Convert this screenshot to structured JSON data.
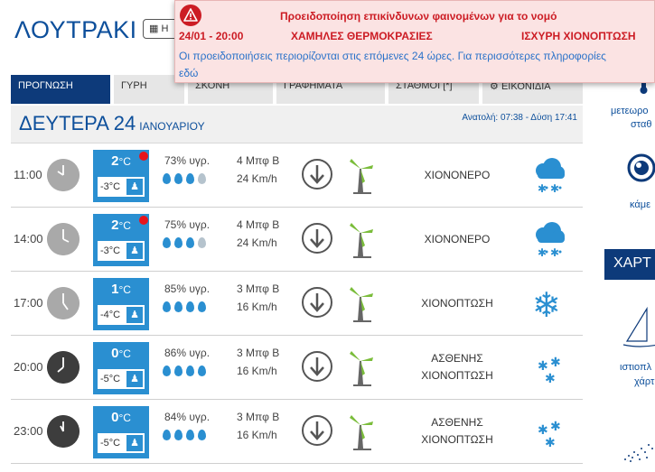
{
  "header": {
    "city": "ΛΟΥΤΡΑΚΙ",
    "date_button": "Η"
  },
  "tabs": [
    {
      "label": "ΠΡΟΓΝΩΣΗ",
      "active": true
    },
    {
      "label": "ΓΥΡΗ",
      "active": false
    },
    {
      "label": "ΣΚΟΝΗ",
      "active": false
    },
    {
      "label": "ΓΡΑΦΗΜΑΤΑ",
      "active": false
    },
    {
      "label": "ΣΤΑΘΜΟΙ [*]",
      "active": false
    },
    {
      "label": "ΕΙΚΟΝΙΔΙΑ",
      "active": false
    }
  ],
  "day": {
    "name": "ΔΕΥΤΕΡΑ 24",
    "month": "ΙΑΝΟΥΑΡΙΟΥ",
    "sun": "Ανατολή: 07:38 - Δύση 17:41"
  },
  "rows": [
    {
      "time": "11:00",
      "temp": "2",
      "temp_unit": "°C",
      "feel": "-3°C",
      "humidity": "73% υγρ.",
      "drops_full": 3,
      "wind_bf": "4 Μπφ Β",
      "wind_kmh": "24 Km/h",
      "cond": [
        "ΧΙΟΝΟΝΕΡΟ"
      ],
      "icon": "cloud-snow-icon",
      "warning": true,
      "night": false
    },
    {
      "time": "14:00",
      "temp": "2",
      "temp_unit": "°C",
      "feel": "-3°C",
      "humidity": "75% υγρ.",
      "drops_full": 3,
      "wind_bf": "4 Μπφ Β",
      "wind_kmh": "24 Km/h",
      "cond": [
        "ΧΙΟΝΟΝΕΡΟ"
      ],
      "icon": "cloud-snow-icon",
      "warning": true,
      "night": false
    },
    {
      "time": "17:00",
      "temp": "1",
      "temp_unit": "°C",
      "feel": "-4°C",
      "humidity": "85% υγρ.",
      "drops_full": 4,
      "wind_bf": "3 Μπφ Β",
      "wind_kmh": "16 Km/h",
      "cond": [
        "ΧΙΟΝΟΠΤΩΣΗ"
      ],
      "icon": "snowflake-icon",
      "warning": false,
      "night": false
    },
    {
      "time": "20:00",
      "temp": "0",
      "temp_unit": "°C",
      "feel": "-5°C",
      "humidity": "86% υγρ.",
      "drops_full": 4,
      "wind_bf": "3 Μπφ Β",
      "wind_kmh": "16 Km/h",
      "cond": [
        "ΑΣΘΕΝΗΣ",
        "ΧΙΟΝΟΠΤΩΣΗ"
      ],
      "icon": "light-snow-icon",
      "warning": false,
      "night": true
    },
    {
      "time": "23:00",
      "temp": "0",
      "temp_unit": "°C",
      "feel": "-5°C",
      "humidity": "84% υγρ.",
      "drops_full": 4,
      "wind_bf": "3 Μπφ Β",
      "wind_kmh": "16 Km/h",
      "cond": [
        "ΑΣΘΕΝΗΣ",
        "ΧΙΟΝΟΠΤΩΣΗ"
      ],
      "icon": "light-snow-icon",
      "warning": false,
      "night": true
    }
  ],
  "sidebar": {
    "stations_line1": "μετεωρο",
    "stations_line2": "σταθ",
    "cameras": "κάμε",
    "maps_title": "ΧΑΡΤ",
    "history_line1": "ιστιοπλ",
    "history_line2": "χάρτ"
  },
  "alert": {
    "title": "Προειδοποίηση επικίνδυνων φαινομένων για το νομό",
    "date": "24/01 - 20:00",
    "type1": "ΧΑΜΗΛΕΣ ΘΕΡΜΟΚΡΑΣΙΕΣ",
    "type2": "ΙΣΧΥΡΗ ΧΙΟΝΟΠΤΩΣΗ",
    "info": "Οι προειδοποιήσεις περιορίζονται στις επόμενες 24 ώρες. Για περισσότερες πληροφορίες",
    "link": "εδώ"
  },
  "colors": {
    "brand": "#0d3a7a",
    "temp_box": "#2a8fd1",
    "alert_red": "#cc1c24"
  }
}
